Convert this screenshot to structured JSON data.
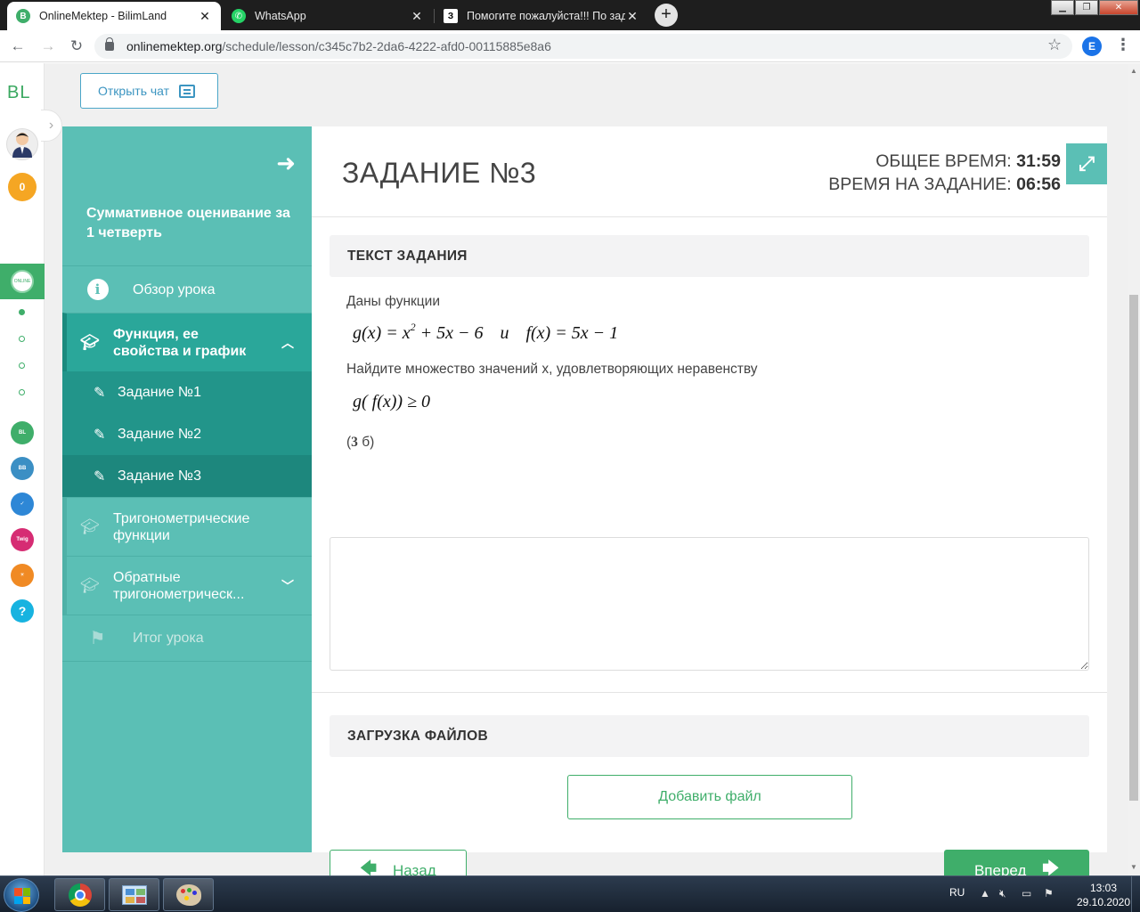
{
  "browser": {
    "tabs": [
      {
        "title": "OnlineMektep - BilimLand",
        "favicon": "bilimland-icon",
        "active": true
      },
      {
        "title": "WhatsApp",
        "favicon": "whatsapp-icon",
        "active": false
      },
      {
        "title": "Помогите пожалуйста!!! По зад",
        "favicon": "znanija-icon",
        "active": false
      }
    ],
    "new_tab_symbol": "+",
    "url_host": "onlinemektep.org",
    "url_path": "/schedule/lesson/c345c7b2-2da6-4222-afd0-00115885e8a6",
    "profile_initial": "E"
  },
  "rail": {
    "logo": "BL",
    "coins": "0",
    "help": "?"
  },
  "chat_button": "Открыть чат",
  "lesson": {
    "title": "Суммативное оценивание за 1 четверть",
    "items": {
      "overview": "Обзор урока",
      "topic1": "Функция, ее свойства и график",
      "task1": "Задание №1",
      "task2": "Задание №2",
      "task3": "Задание №3",
      "topic2": "Тригонометрические функции",
      "topic3": "Обратные тригонометрическ...",
      "summary": "Итог урока"
    }
  },
  "task": {
    "title": "ЗАДАНИЕ №3",
    "total_time_label": "ОБЩЕЕ ВРЕМЯ:",
    "total_time": "31:59",
    "task_time_label": "ВРЕМЯ НА ЗАДАНИЕ:",
    "task_time": "06:56",
    "text_header": "ТЕКСТ ЗАДАНИЯ",
    "intro": "Даны функции",
    "formula1_g": "g(x) = x",
    "formula1_exp": "2",
    "formula1_rest": " + 5x − 6",
    "formula1_conj": "и",
    "formula1_f": "f(x) = 5x − 1",
    "question": "Найдите множество значений х, удовлетворяющих неравенству",
    "formula2": "g( f(x)) ≥ 0",
    "points_open": "(",
    "points_num": "3",
    "points_rest": " б)",
    "upload_header": "ЗАГРУЗКА ФАЙЛОВ",
    "add_file": "Добавить файл",
    "back": "Назад",
    "next": "Вперед"
  },
  "taskbar": {
    "lang": "RU",
    "time": "13:03",
    "date": "29.10.2020"
  },
  "colors": {
    "sidebar": "#5bbfb5",
    "sidebar_active": "#2aa79a",
    "green": "#3fae6a",
    "chat_blue": "#3c95c1"
  }
}
